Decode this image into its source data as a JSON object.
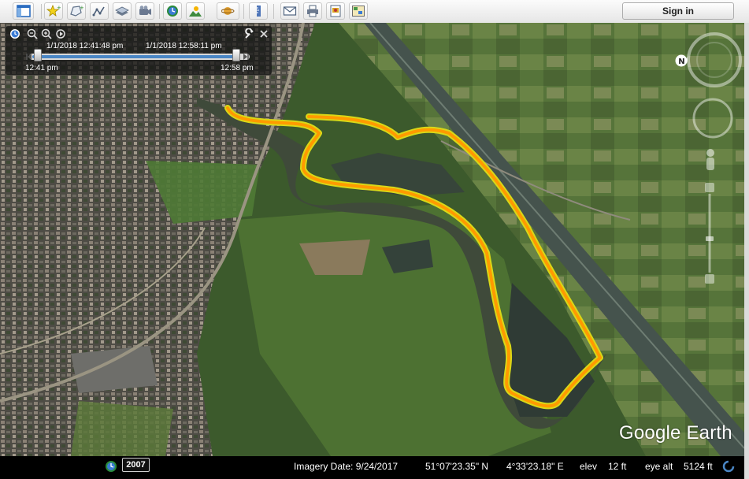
{
  "toolbar": {
    "buttons": [
      {
        "icon": "sidebar-icon"
      },
      {
        "icon": "add-placemark-icon"
      },
      {
        "icon": "add-polygon-icon"
      },
      {
        "icon": "add-path-icon"
      },
      {
        "icon": "add-image-overlay-icon"
      },
      {
        "icon": "record-tour-icon"
      },
      {
        "icon": "historical-imagery-icon"
      },
      {
        "icon": "sunlight-icon"
      },
      {
        "icon": "planet-icon"
      },
      {
        "icon": "ruler-icon"
      },
      {
        "icon": "email-icon"
      },
      {
        "icon": "print-icon"
      },
      {
        "icon": "save-image-icon"
      },
      {
        "icon": "view-in-maps-icon"
      }
    ],
    "signin_label": "Sign in"
  },
  "time_slider": {
    "start_datetime": "1/1/2018   12:41:48 pm",
    "end_datetime": "1/1/2018   12:58:11 pm",
    "start_label": "12:41 pm",
    "end_label": "12:58 pm"
  },
  "status": {
    "year": "2007",
    "imagery_date": "Imagery Date: 9/24/2017",
    "latitude": "51°07'23.35\" N",
    "longitude": "4°33'23.18\" E",
    "elev_label": "elev",
    "elev_value": "12 ft",
    "eye_alt_label": "eye alt",
    "eye_alt_value": "5124 ft"
  },
  "logo_text": "Google Earth",
  "colors": {
    "track": "#ff9a00",
    "track_edge": "#d8d818",
    "water": "#2f3b35",
    "canal": "#45534d"
  }
}
